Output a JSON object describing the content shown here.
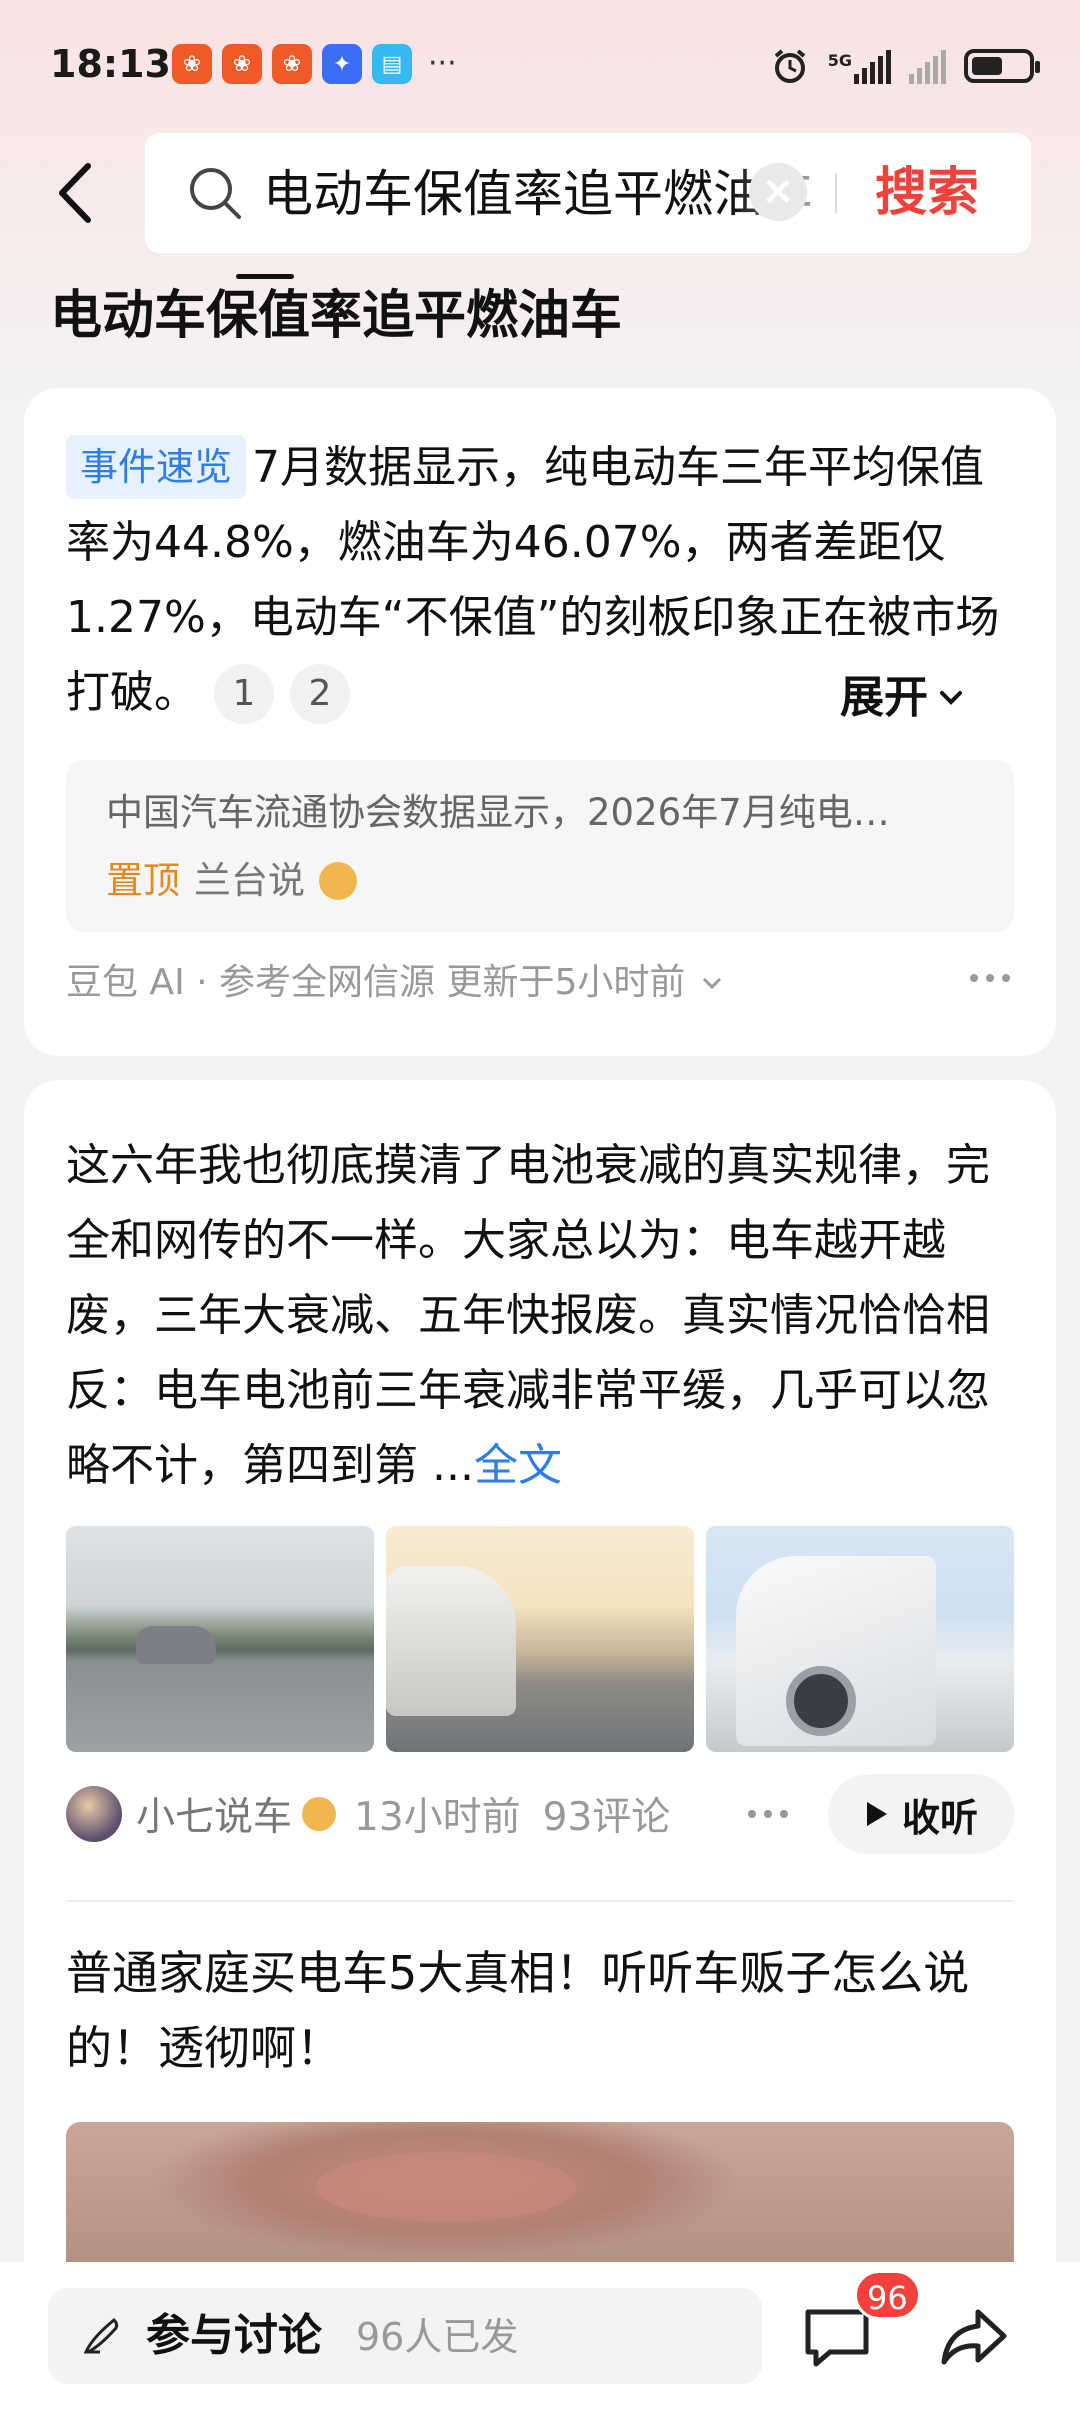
{
  "status_bar": {
    "time": "18:13",
    "network": "5G",
    "app_icons": [
      {
        "name": "app-icon-1",
        "color": "#f05a28"
      },
      {
        "name": "app-icon-2",
        "color": "#f05a28"
      },
      {
        "name": "app-icon-3",
        "color": "#f05a28"
      },
      {
        "name": "app-icon-4",
        "color": "#3b6ef5"
      },
      {
        "name": "app-icon-5",
        "color": "#36b9f0"
      }
    ]
  },
  "search": {
    "query": "电动车保值率追平燃油车",
    "button_label": "搜索"
  },
  "page_title": "电动车保值率追平燃油车",
  "summary_card": {
    "tag": "事件速览",
    "text": "7月数据显示，纯电动车三年平均保值率为44.8%，燃油车为46.07%，两者差距仅1.27%，电动车“不保值”的刻板印象正在被市场打破。",
    "citations": [
      "1",
      "2"
    ],
    "expand_label": "展开",
    "source_snippet": "中国汽车流通协会数据显示，2026年7月纯电…",
    "pinned_label": "置顶",
    "source_author": "兰台说",
    "footer": "豆包 AI · 参考全网信源 更新于5小时前"
  },
  "post1": {
    "text": "这六年我也彻底摸清了电池衰减的真实规律，完全和网传的不一样。大家总以为：电车越开越废，三年大衰减、五年快报废。真实情况恰恰相反：电车电池前三年衰减非常平缓，几乎可以忽略不计，第四到第",
    "ellipsis": "...",
    "full_text_link": "全文",
    "author": "小七说车",
    "time": "13小时前",
    "comments": "93评论",
    "listen_label": "收听"
  },
  "post2": {
    "title": "普通家庭买电车5大真相！听听车贩子怎么说的！透彻啊！"
  },
  "bottom_bar": {
    "discuss_label": "参与讨论",
    "discuss_count": "96人已发",
    "comment_badge": "96"
  },
  "colors": {
    "accent_red": "#f0423b",
    "link_blue": "#2d7ee8",
    "pin_orange": "#e38a1d"
  }
}
